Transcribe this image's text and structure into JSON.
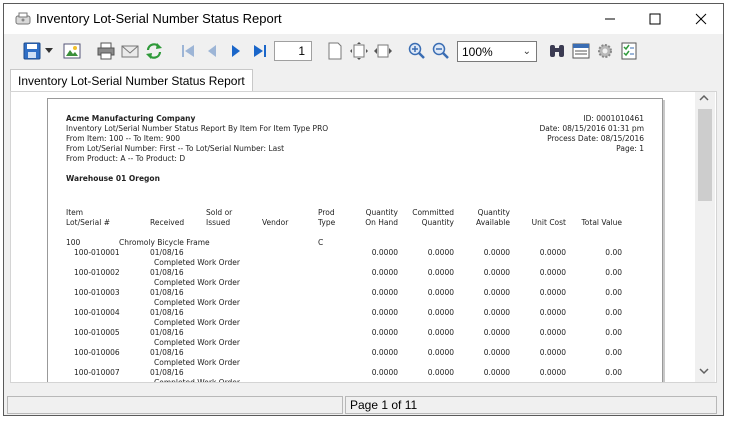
{
  "window": {
    "title": "Inventory Lot-Serial Number Status Report",
    "minimize": "—",
    "maximize": "☐",
    "close": "✕"
  },
  "toolbar": {
    "page_number": "1",
    "zoom_value": "100%"
  },
  "tab": {
    "label": "Inventory Lot-Serial Number Status Report"
  },
  "report": {
    "company": "Acme Manufacturing Company",
    "title_line": "Inventory Lot/Serial Number Status Report By Item For Item Type PRO",
    "from_item_line": "From Item: 100          -- To Item: 900",
    "from_lot_line": "From Lot/Serial Number:  First -- To Lot/Serial Number: Last",
    "from_product_line": "From Product: A     -- To Product: D",
    "id_line": "ID: 0001010461",
    "date_line": "Date: 08/15/2016 01:31 pm",
    "process_date_line": "Process Date: 08/15/2016",
    "page_line": "Page: 1",
    "warehouse": "Warehouse 01 Oregon",
    "headers": {
      "item": "Item",
      "lot_serial": "Lot/Serial #",
      "received": "Received",
      "sold_or": "Sold or",
      "issued": "Issued",
      "vendor": "Vendor",
      "prod": "Prod",
      "type": "Type",
      "quantity1": "Quantity",
      "on_hand": "On Hand",
      "committed": "Committed",
      "quantity2": "Quantity",
      "quantity3": "Quantity",
      "available": "Available",
      "unit_cost": "Unit Cost",
      "total_value": "Total Value"
    },
    "item_row": {
      "item": "100",
      "description": "Chromoly Bicycle Frame",
      "prod_type": "C"
    },
    "rows": [
      {
        "lot": "100-010001",
        "received": "01/08/16",
        "note": "Completed Work Order",
        "on_hand": "0.0000",
        "committed": "0.0000",
        "available": "0.0000",
        "unit_cost": "0.0000",
        "total": "0.00"
      },
      {
        "lot": "100-010002",
        "received": "01/08/16",
        "note": "Completed Work Order",
        "on_hand": "0.0000",
        "committed": "0.0000",
        "available": "0.0000",
        "unit_cost": "0.0000",
        "total": "0.00"
      },
      {
        "lot": "100-010003",
        "received": "01/08/16",
        "note": "Completed Work Order",
        "on_hand": "0.0000",
        "committed": "0.0000",
        "available": "0.0000",
        "unit_cost": "0.0000",
        "total": "0.00"
      },
      {
        "lot": "100-010004",
        "received": "01/08/16",
        "note": "Completed Work Order",
        "on_hand": "0.0000",
        "committed": "0.0000",
        "available": "0.0000",
        "unit_cost": "0.0000",
        "total": "0.00"
      },
      {
        "lot": "100-010005",
        "received": "01/08/16",
        "note": "Completed Work Order",
        "on_hand": "0.0000",
        "committed": "0.0000",
        "available": "0.0000",
        "unit_cost": "0.0000",
        "total": "0.00"
      },
      {
        "lot": "100-010006",
        "received": "01/08/16",
        "note": "Completed Work Order",
        "on_hand": "0.0000",
        "committed": "0.0000",
        "available": "0.0000",
        "unit_cost": "0.0000",
        "total": "0.00"
      },
      {
        "lot": "100-010007",
        "received": "01/08/16",
        "note": "Completed Work Order",
        "on_hand": "0.0000",
        "committed": "0.0000",
        "available": "0.0000",
        "unit_cost": "0.0000",
        "total": "0.00"
      }
    ]
  },
  "status": {
    "page_text": "Page 1 of 11"
  },
  "icons": {
    "save": "save-icon",
    "export": "export-image-icon",
    "print": "print-icon",
    "email": "email-icon",
    "refresh": "refresh-icon",
    "first": "first-page-icon",
    "prev": "prev-page-icon",
    "next": "next-page-icon",
    "last": "last-page-icon",
    "fit_page": "fit-page-icon",
    "fit_width": "fit-width-icon",
    "zoom_in": "zoom-in-icon",
    "zoom_out": "zoom-out-icon",
    "find": "binoculars-icon"
  },
  "colors": {
    "accent_blue": "#1a66c9",
    "refresh_green": "#2f9a3a",
    "page_bg": "#ffffff",
    "chrome": "#f0f0f0"
  }
}
